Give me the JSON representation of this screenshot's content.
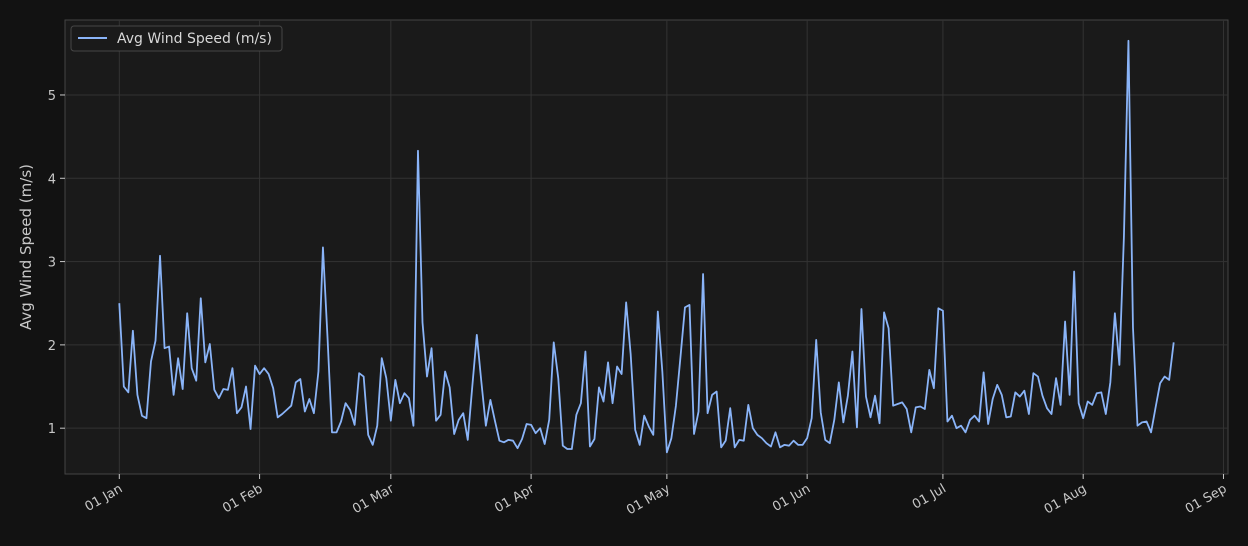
{
  "colors": {
    "page_background": "#121212",
    "plot_background": "#1a1a1a",
    "grid": "#333333",
    "axes": "#444444",
    "line": "#8ab4f8",
    "text": "#c8c8c8"
  },
  "chart_data": {
    "type": "line",
    "title": "",
    "xlabel": "",
    "ylabel": "Avg Wind Speed (m/s)",
    "grid": true,
    "legend_placement": "top-left",
    "xlim": [
      "2023-12-20",
      "2024-09-02"
    ],
    "ylim": [
      0.45,
      5.9
    ],
    "x_ticks": [
      {
        "date": "2024-01-01",
        "label": "01 Jan"
      },
      {
        "date": "2024-02-01",
        "label": "01 Feb"
      },
      {
        "date": "2024-03-01",
        "label": "01 Mar"
      },
      {
        "date": "2024-04-01",
        "label": "01 Apr"
      },
      {
        "date": "2024-05-01",
        "label": "01 May"
      },
      {
        "date": "2024-06-01",
        "label": "01 Jun"
      },
      {
        "date": "2024-07-01",
        "label": "01 Jul"
      },
      {
        "date": "2024-08-01",
        "label": "01 Aug"
      },
      {
        "date": "2024-09-01",
        "label": "01 Sep"
      }
    ],
    "y_ticks": [
      1,
      2,
      3,
      4,
      5
    ],
    "series": [
      {
        "name": "Avg Wind Speed (m/s)",
        "start_date": "2024-01-01",
        "step_days": 1,
        "values": [
          2.5,
          1.5,
          1.43,
          2.17,
          1.4,
          1.15,
          1.12,
          1.8,
          2.05,
          3.07,
          1.96,
          1.98,
          1.4,
          1.84,
          1.47,
          2.38,
          1.72,
          1.57,
          2.56,
          1.79,
          2.01,
          1.46,
          1.36,
          1.47,
          1.46,
          1.72,
          1.18,
          1.25,
          1.5,
          0.99,
          1.75,
          1.65,
          1.72,
          1.65,
          1.48,
          1.13,
          1.17,
          1.22,
          1.27,
          1.55,
          1.59,
          1.2,
          1.35,
          1.18,
          1.68,
          3.17,
          2.1,
          0.95,
          0.95,
          1.08,
          1.3,
          1.22,
          1.04,
          1.66,
          1.62,
          0.92,
          0.8,
          1.03,
          1.84,
          1.6,
          1.09,
          1.58,
          1.3,
          1.42,
          1.36,
          1.03,
          4.33,
          2.27,
          1.62,
          1.96,
          1.09,
          1.16,
          1.68,
          1.49,
          0.93,
          1.1,
          1.18,
          0.86,
          1.5,
          2.12,
          1.56,
          1.03,
          1.34,
          1.09,
          0.85,
          0.83,
          0.86,
          0.85,
          0.76,
          0.87,
          1.05,
          1.04,
          0.94,
          1.0,
          0.81,
          1.1,
          2.03,
          1.6,
          0.79,
          0.75,
          0.75,
          1.16,
          1.3,
          1.92,
          0.78,
          0.87,
          1.49,
          1.32,
          1.79,
          1.3,
          1.74,
          1.65,
          2.51,
          1.89,
          0.98,
          0.8,
          1.15,
          1.02,
          0.92,
          2.4,
          1.68,
          0.71,
          0.88,
          1.27,
          1.85,
          2.45,
          2.48,
          0.93,
          1.2,
          2.85,
          1.18,
          1.4,
          1.44,
          0.77,
          0.85,
          1.24,
          0.77,
          0.86,
          0.85,
          1.28,
          1.0,
          0.92,
          0.88,
          0.82,
          0.78,
          0.95,
          0.77,
          0.8,
          0.79,
          0.85,
          0.8,
          0.8,
          0.88,
          1.12,
          2.06,
          1.19,
          0.86,
          0.82,
          1.1,
          1.55,
          1.07,
          1.39,
          1.92,
          1.01,
          2.43,
          1.38,
          1.13,
          1.39,
          1.06,
          2.39,
          2.2,
          1.27,
          1.29,
          1.31,
          1.23,
          0.95,
          1.25,
          1.26,
          1.23,
          1.7,
          1.48,
          2.44,
          2.41,
          1.08,
          1.15,
          1.0,
          1.03,
          0.95,
          1.1,
          1.15,
          1.08,
          1.67,
          1.05,
          1.35,
          1.52,
          1.4,
          1.13,
          1.14,
          1.43,
          1.38,
          1.45,
          1.17,
          1.66,
          1.62,
          1.39,
          1.24,
          1.17,
          1.6,
          1.28,
          2.28,
          1.4,
          2.88,
          1.3,
          1.12,
          1.32,
          1.28,
          1.42,
          1.43,
          1.17,
          1.55,
          2.38,
          1.76,
          3.3,
          5.65,
          2.21,
          1.03,
          1.07,
          1.08,
          0.95,
          1.25,
          1.54,
          1.62,
          1.58,
          2.03
        ]
      }
    ]
  }
}
